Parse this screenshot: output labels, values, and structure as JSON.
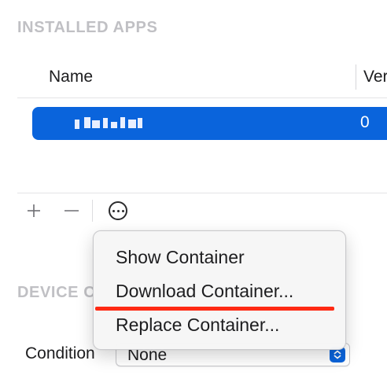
{
  "installed_apps": {
    "header": "INSTALLED APPS",
    "columns": {
      "name": "Name",
      "version": "Ver"
    },
    "rows": [
      {
        "name": "(pixelated)",
        "version": "0",
        "selected": true
      }
    ],
    "toolbar": {
      "add_icon": "plus-icon",
      "remove_icon": "minus-icon",
      "more_icon": "ellipsis-circle-icon"
    }
  },
  "device_section": {
    "header": "DEVICE C",
    "condition_label": "Condition",
    "condition_value": "None"
  },
  "context_menu": {
    "items": [
      {
        "label": "Show Container"
      },
      {
        "label": "Download Container..."
      },
      {
        "label": "Replace Container..."
      }
    ]
  },
  "colors": {
    "selection": "#0a64dc",
    "annotation_underline": "#ff2a14",
    "section_header": "#c0c0c4"
  }
}
